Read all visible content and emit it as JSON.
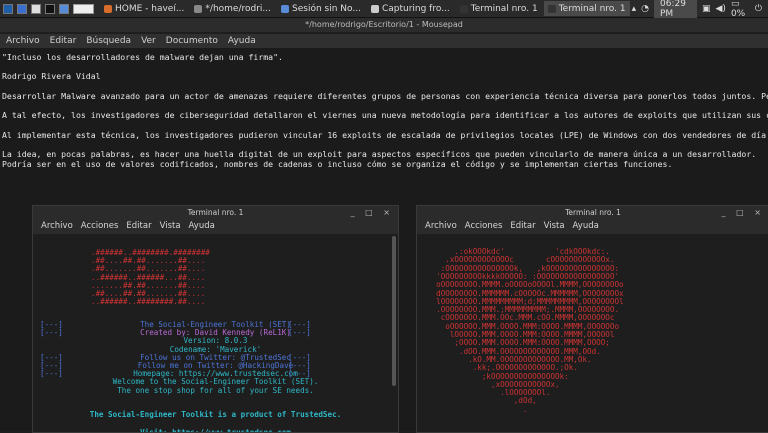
{
  "taskbar": {
    "tasks": [
      {
        "label": "HOME - haveí...",
        "color": "#d96d2b"
      },
      {
        "label": "*/home/rodri...",
        "color": "#888888"
      },
      {
        "label": "Sesión sin No...",
        "color": "#5a8bd6"
      },
      {
        "label": "Capturing fro...",
        "color": "#cccccc"
      },
      {
        "label": "Terminal nro. 1",
        "color": "#333333"
      },
      {
        "label": "Terminal nro. 1",
        "color": "#333333",
        "active": true
      }
    ],
    "clock": "06:29 PM",
    "battery": "0%"
  },
  "editor": {
    "title": "*/home/rodrigo/Escritorio/1 - Mousepad",
    "menu": [
      "Archivo",
      "Editar",
      "Búsqueda",
      "Ver",
      "Documento",
      "Ayuda"
    ],
    "lines": [
      "\"Incluso los desarrolladores de malware dejan una firma\".",
      "",
      "Rodrigo Rivera Vidal",
      "",
      "Desarrollar Malware avanzado para un actor de amenazas requiere diferentes grupos de personas con experiencia técnica diversa para ponerlos todos juntos. Pero, ¿puede el c",
      "",
      "A tal efecto, los investigadores de ciberseguridad detallaron el viernes una nueva metodología para identificar a los autores de exploits que utilizan sus características",
      "",
      "Al implementar esta técnica, los investigadores pudieron vincular 16 exploits de escalada de privilegios locales (LPE) de Windows con dos vendedores de día cero \"Volodya\"",
      "",
      "La idea, en pocas palabras, es hacer una huella digital de un exploit para aspectos específicos que pueden vincularlo de manera única a un desarrollador.",
      "Podría ser en el uso de valores codificados, nombres de cadenas o incluso cómo se organiza el código y se implementan ciertas funciones."
    ]
  },
  "term_left": {
    "title": "Terminal nro. 1",
    "controls": "_ □ ×",
    "menu": [
      "Archivo",
      "Acciones",
      "Editar",
      "Vista",
      "Ayuda"
    ],
    "banner": [
      ".######..########.########",
      ".##....##.##.......##....",
      ".##.......##.......##....",
      "..######..######...##....",
      ".......##.##.......##....",
      ".##....##.##.......##....",
      "..######..########.##...."
    ],
    "info": [
      {
        "l": "[---]",
        "t": "The Social-Engineer Toolkit (SET)",
        "r": "[---]"
      },
      {
        "l": "[---]",
        "t": "Created by: David Kennedy (ReL1K)",
        "r": "[---]"
      },
      {
        "l": "",
        "t": "Version: 8.0.3",
        "r": ""
      },
      {
        "l": "",
        "t": "Codename: 'Maverick'",
        "r": ""
      },
      {
        "l": "[---]",
        "t": "Follow us on Twitter: @TrustedSec",
        "r": "[---]"
      },
      {
        "l": "[---]",
        "t": "Follow me on Twitter: @HackingDave",
        "r": "[---]"
      },
      {
        "l": "[---]",
        "t": "Homepage: https://www.trustedsec.com",
        "r": "[---]"
      },
      {
        "l": "",
        "t": "Welcome to the Social-Engineer Toolkit (SET).",
        "r": ""
      },
      {
        "l": "",
        "t": "The one stop shop for all of your SE needs.",
        "r": ""
      }
    ],
    "product": "The Social-Engineer Toolkit is a product of TrustedSec.",
    "visit": "Visit: https://www.trustedsec.com"
  },
  "term_right": {
    "title": "Terminal nro. 1",
    "controls": "_ □ ×",
    "menu": [
      "Archivo",
      "Acciones",
      "Editar",
      "Vista",
      "Ayuda"
    ],
    "art": [
      "      .:okOOOkdc'           'cdkOOOkdc:.",
      "    .xOOOOOOOOOOOOc       cOOOOOOOOOOOOx.",
      "   :OOOOOOOOOOOOOOOk,   ,kOOOOOOOOOOOOOOO:",
      "  'OOOOOOOOOkkkkOOOOO: :OOOOOOOOOOOOOOOOO'",
      "  oOOOOOOOO.MMMM.oOOOOoOOOOl.MMMM,OOOOOOOOo",
      "  dOOOOOOOO.MMMMMM.cOOOOOc.MMMMMM,OOOOOOOOx",
      "  lOOOOOOOO.MMMMMMMMM;d;MMMMMMMMM,OOOOOOOOl",
      "  .OOOOOOOO.MMM.;MMMMMMMMM;.MMMM,OOOOOOOO.",
      "   cOOOOOOO.MMM.OOc.MMM.cOO.MMMM,OOOOOOOc",
      "    oOOOOOO.MMM.OOOO.MMM:OOOO.MMMM,OOOOOOo",
      "     lOOOOO.MMM.OOOO.MMM:OOOO.MMMM,OOOOOl",
      "      ;OOOO.MMM.OOOO.MMM:OOOO.MMMM,OOOO;",
      "       .dOO.MMM.OOOOOOOOOOOOO.MMM,OOd.",
      "         .kO.MM.OOOOOOOOOOOOO.MM,Ok.",
      "          .kk;.OOOOOOOOOOOOO.;Ok.",
      "            ;kOOOOOOOOOOOOOOOk:",
      "              ,xOOOOOOOOOOOx,",
      "                .lOOOOOOOl.",
      "                   ,dOd,",
      "                     ."
    ]
  }
}
